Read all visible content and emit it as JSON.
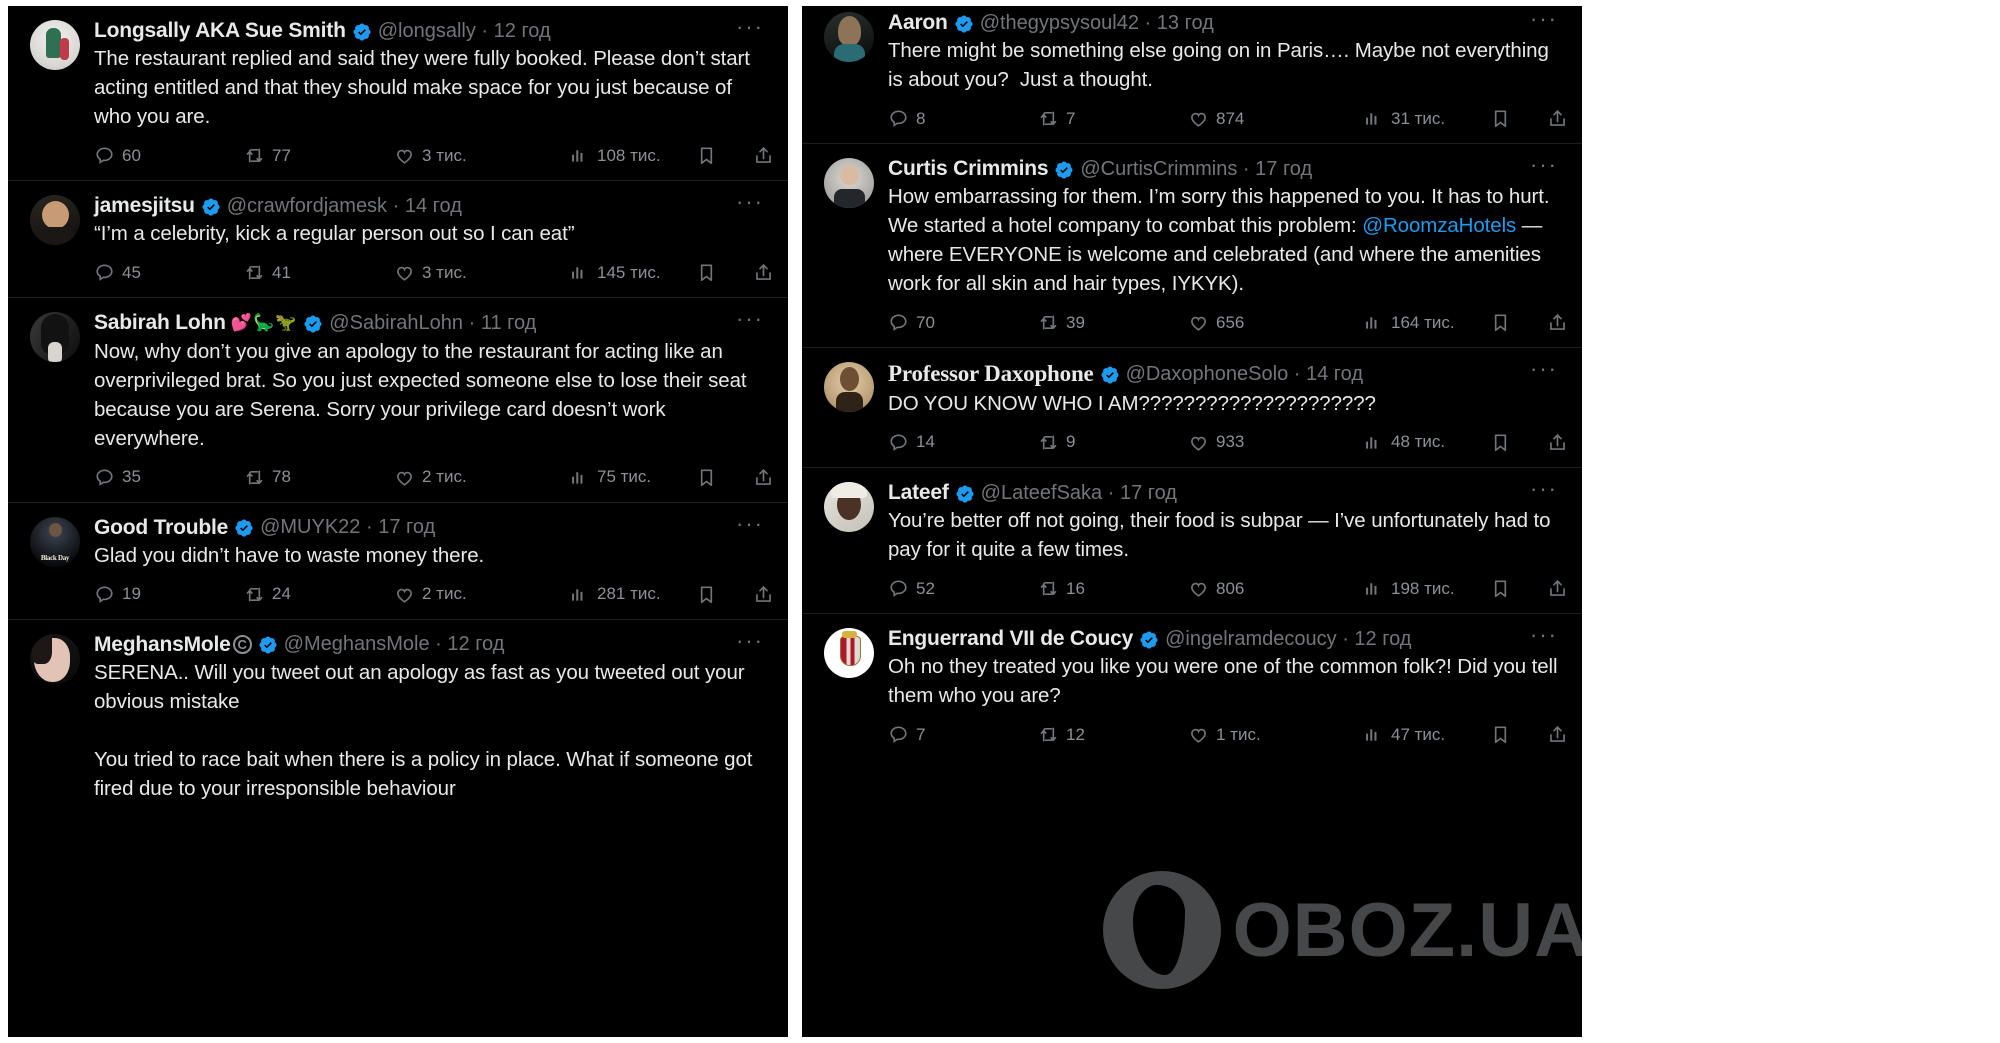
{
  "watermark": {
    "text": "OBOZ.UA"
  },
  "icons": {
    "reply": "reply-icon",
    "retweet": "retweet-icon",
    "like": "like-icon",
    "views": "views-icon",
    "bookmark": "bookmark-icon",
    "share": "share-icon",
    "more": "more-options-icon",
    "verified": "verified-badge-icon"
  },
  "left_column": {
    "tweets": [
      {
        "display_name": "Longsally AKA Sue Smith",
        "name_emojis": "",
        "verified": true,
        "handle": "@longsally",
        "separator": "·",
        "time": "12 год",
        "text": "The restaurant replied and said they were fully booked. Please don’t start acting entitled and that they should make space for you just because of who you are.",
        "replies": "60",
        "retweets": "77",
        "likes": "3 тис.",
        "views": "108 тис.",
        "more": "···"
      },
      {
        "display_name": "jamesjitsu",
        "name_emojis": "",
        "verified": true,
        "handle": "@crawfordjamesk",
        "separator": "·",
        "time": "14 год",
        "text": "“I’m a celebrity, kick a regular person out so I can eat”",
        "replies": "45",
        "retweets": "41",
        "likes": "3 тис.",
        "views": "145 тис.",
        "more": "···"
      },
      {
        "display_name": "Sabirah Lohn",
        "name_emojis": "💕🦕🦖",
        "verified": true,
        "handle": "@SabirahLohn",
        "separator": "·",
        "time": "11 год",
        "text": "Now, why don’t you give an apology to the restaurant for acting like an overprivileged brat. So you just expected someone else to lose their seat because you are Serena. Sorry your privilege card doesn’t work everywhere.",
        "replies": "35",
        "retweets": "78",
        "likes": "2 тис.",
        "views": "75 тис.",
        "more": "···"
      },
      {
        "display_name": "Good Trouble",
        "name_emojis": "",
        "verified": true,
        "handle": "@MUYK22",
        "separator": "·",
        "time": "17 год",
        "text": "Glad you didn’t have to waste money there.",
        "replies": "19",
        "retweets": "24",
        "likes": "2 тис.",
        "views": "281 тис.",
        "more": "···"
      },
      {
        "display_name": "MeghansMole",
        "name_badge": "Ⓒ",
        "name_emojis": "",
        "verified": true,
        "handle": "@MeghansMole",
        "separator": "·",
        "time": "12 год",
        "text": "SERENA.. Will you tweet out an apology as fast as you tweeted out your obvious mistake\n\nYou tried to race bait when there is a policy in place. What if someone got fired due to your irresponsible behaviour",
        "replies": "",
        "retweets": "",
        "likes": "",
        "views": "",
        "more": "···"
      }
    ]
  },
  "right_column": {
    "tweets": [
      {
        "display_name": "Aaron",
        "verified": true,
        "handle": "@thegypsysoul42",
        "separator": "·",
        "time": "13 год",
        "text": "There might be something else going on in Paris…. Maybe not everything is about you?  Just a thought.",
        "replies": "8",
        "retweets": "7",
        "likes": "874",
        "views": "31 тис.",
        "more": "···"
      },
      {
        "display_name": "Curtis Crimmins",
        "verified": true,
        "handle": "@CurtisCrimmins",
        "separator": "·",
        "time": "17 год",
        "text_part1": "How embarrassing for them. I’m sorry this happened to you. It has to hurt. We started a hotel company to combat this problem: ",
        "mention": "@RoomzaHotels",
        "text_part2": " — where EVERYONE is welcome and celebrated (and where the amenities work for all skin and hair types, IYKYK).",
        "replies": "70",
        "retweets": "39",
        "likes": "656",
        "views": "164 тис.",
        "more": "···"
      },
      {
        "display_name": "Professor Daxophone",
        "serif_name": true,
        "verified": true,
        "handle": "@DaxophoneSolo",
        "separator": "·",
        "time": "14 год",
        "text": "DO YOU KNOW WHO I AM?????????????????????",
        "replies": "14",
        "retweets": "9",
        "likes": "933",
        "views": "48 тис.",
        "more": "···"
      },
      {
        "display_name": "Lateef",
        "verified": true,
        "handle": "@LateefSaka",
        "separator": "·",
        "time": "17 год",
        "text": "You’re better off not going, their food is subpar — I’ve unfortunately had to pay for it quite a few times.",
        "replies": "52",
        "retweets": "16",
        "likes": "806",
        "views": "198 тис.",
        "more": "···"
      },
      {
        "display_name": "Enguerrand VII de Coucy",
        "verified": true,
        "handle": "@ingelramdecoucy",
        "separator": "·",
        "time": "12 год",
        "text": "Oh no they treated you like you were one of the common folk?! Did you tell them who you are?",
        "replies": "7",
        "retweets": "12",
        "likes": "1 тис.",
        "views": "47 тис.",
        "more": "···"
      }
    ]
  }
}
